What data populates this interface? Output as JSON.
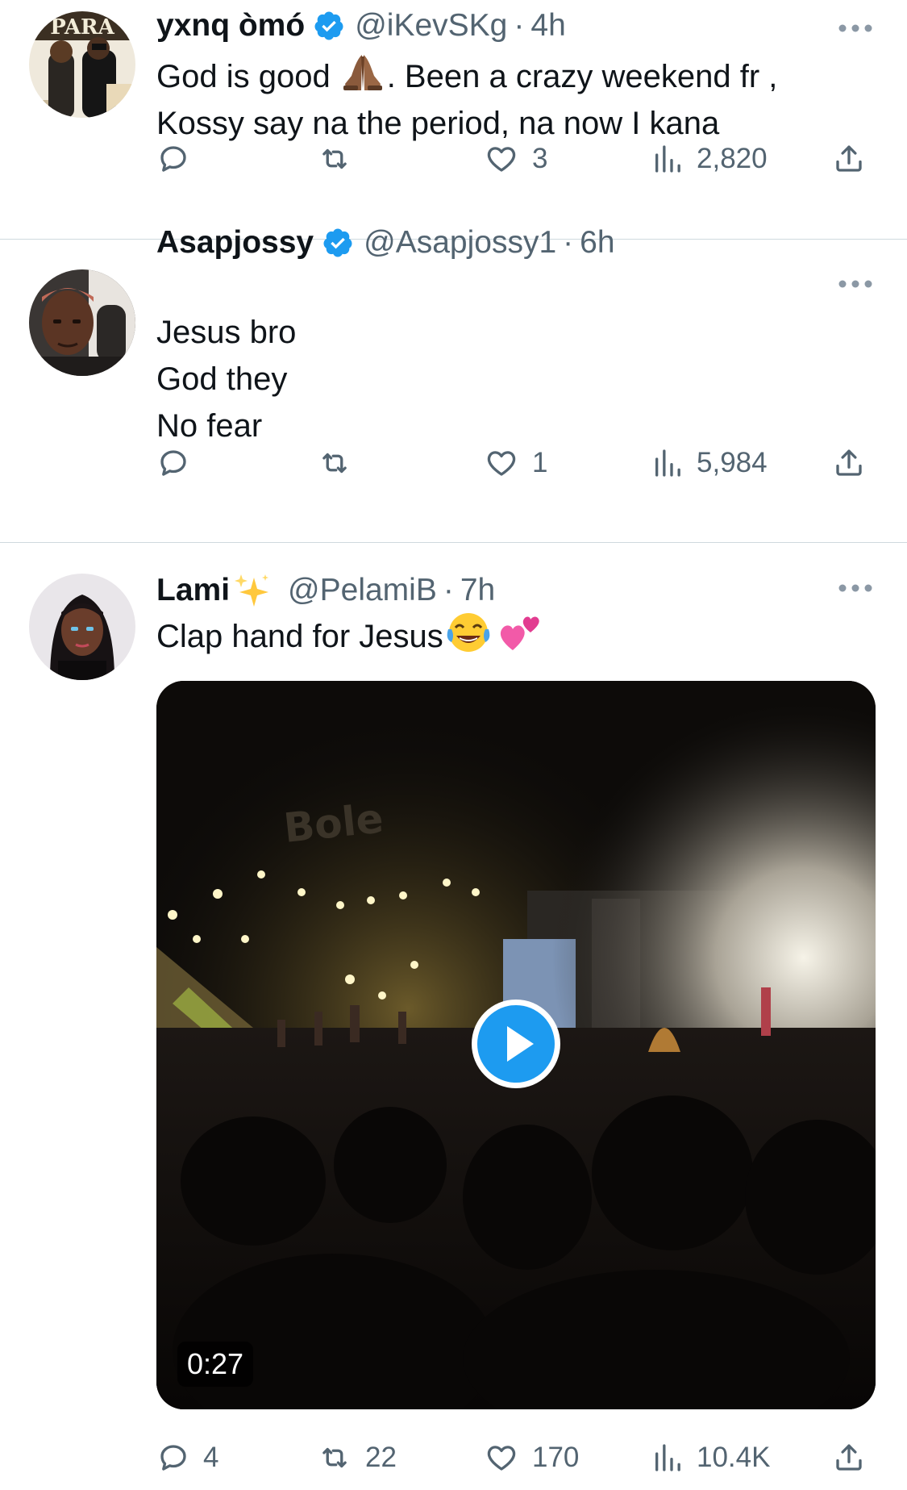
{
  "tweets": [
    {
      "name": "yxnq òmó",
      "verified": true,
      "handle": "@iKevSKg",
      "separator": "·",
      "time": "4h",
      "lines": [
        "God is good",
        ". Been a crazy weekend fr ,",
        "Kossy say na the period, na now I kana"
      ],
      "emoji": "folded-hands-dark",
      "replies": "",
      "retweets": "",
      "likes": "3",
      "views": "2,820",
      "avatar_text": "PARA"
    },
    {
      "name": "Asapjossy",
      "verified": true,
      "handle": "@Asapjossy1",
      "separator": "·",
      "time": "6h",
      "lines": [
        "Jesus bro",
        "God they",
        "No fear"
      ],
      "replies": "",
      "retweets": "",
      "likes": "1",
      "views": "5,984"
    },
    {
      "name": "Lami",
      "name_emoji": "sparkles",
      "verified": false,
      "handle": "@PelamiB",
      "separator": "·",
      "time": "7h",
      "text": "Clap hand for Jesus",
      "text_emojis": [
        "face-with-tears-of-joy",
        "two-hearts"
      ],
      "video": {
        "duration": "0:27",
        "sign_text": "Bole"
      },
      "replies": "4",
      "retweets": "22",
      "likes": "170",
      "views": "10.4K"
    }
  ],
  "colors": {
    "text": "#0f1419",
    "secondary": "#536471",
    "verified_blue": "#1d9bf0",
    "divider": "#cfd9de",
    "play_blue": "#1d9bf0"
  }
}
